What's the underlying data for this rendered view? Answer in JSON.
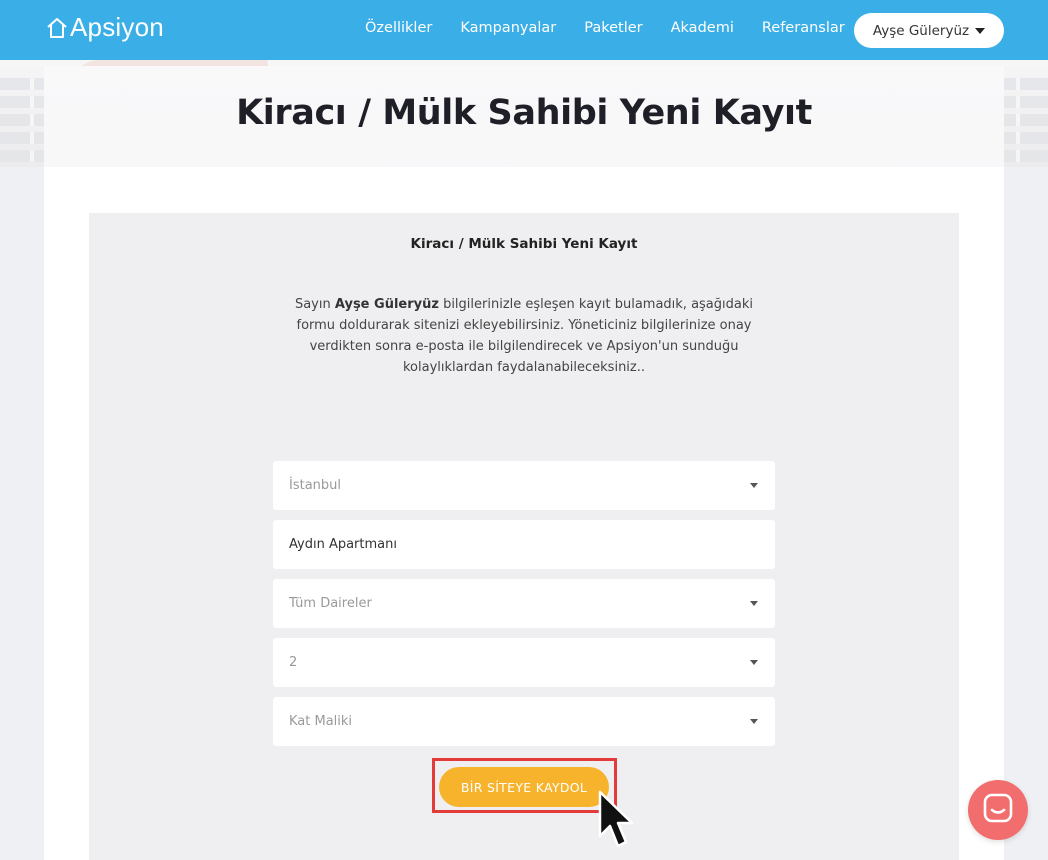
{
  "brand": {
    "name": "Apsiyon"
  },
  "nav": {
    "links": [
      "Özellikler",
      "Kampanyalar",
      "Paketler",
      "Akademi",
      "Referanslar"
    ],
    "user_name": "Ayşe Güleryüz"
  },
  "page": {
    "title": "Kiracı / Mülk Sahibi Yeni Kayıt"
  },
  "form": {
    "heading": "Kiracı / Mülk Sahibi Yeni Kayıt",
    "intro_prefix": "Sayın ",
    "intro_name": "Ayşe Güleryüz",
    "intro_rest": " bilgilerinizle eşleşen kayıt bulamadık, aşağıdaki formu doldurarak sitenizi ekleyebilirsiniz. Yöneticiniz bilgilerinize onay verdikten sonra e-posta ile bilgilendirecek ve Apsiyon'un sunduğu kolaylıklardan faydalanabileceksiniz..",
    "fields": {
      "city": "İstanbul",
      "site": "Aydın Apartmanı",
      "block": "Tüm Daireler",
      "apartment": "2",
      "role": "Kat Maliki"
    },
    "submit_label": "BİR SİTEYE KAYDOL"
  },
  "colors": {
    "navbar": "#3aaee6",
    "submit": "#f7b32b",
    "highlight": "#e33a3a",
    "chat": "#f26d6d"
  },
  "icons": {
    "logo": "home-outline-icon",
    "chat": "chat-smile-icon",
    "cursor": "mouse-pointer-icon"
  }
}
